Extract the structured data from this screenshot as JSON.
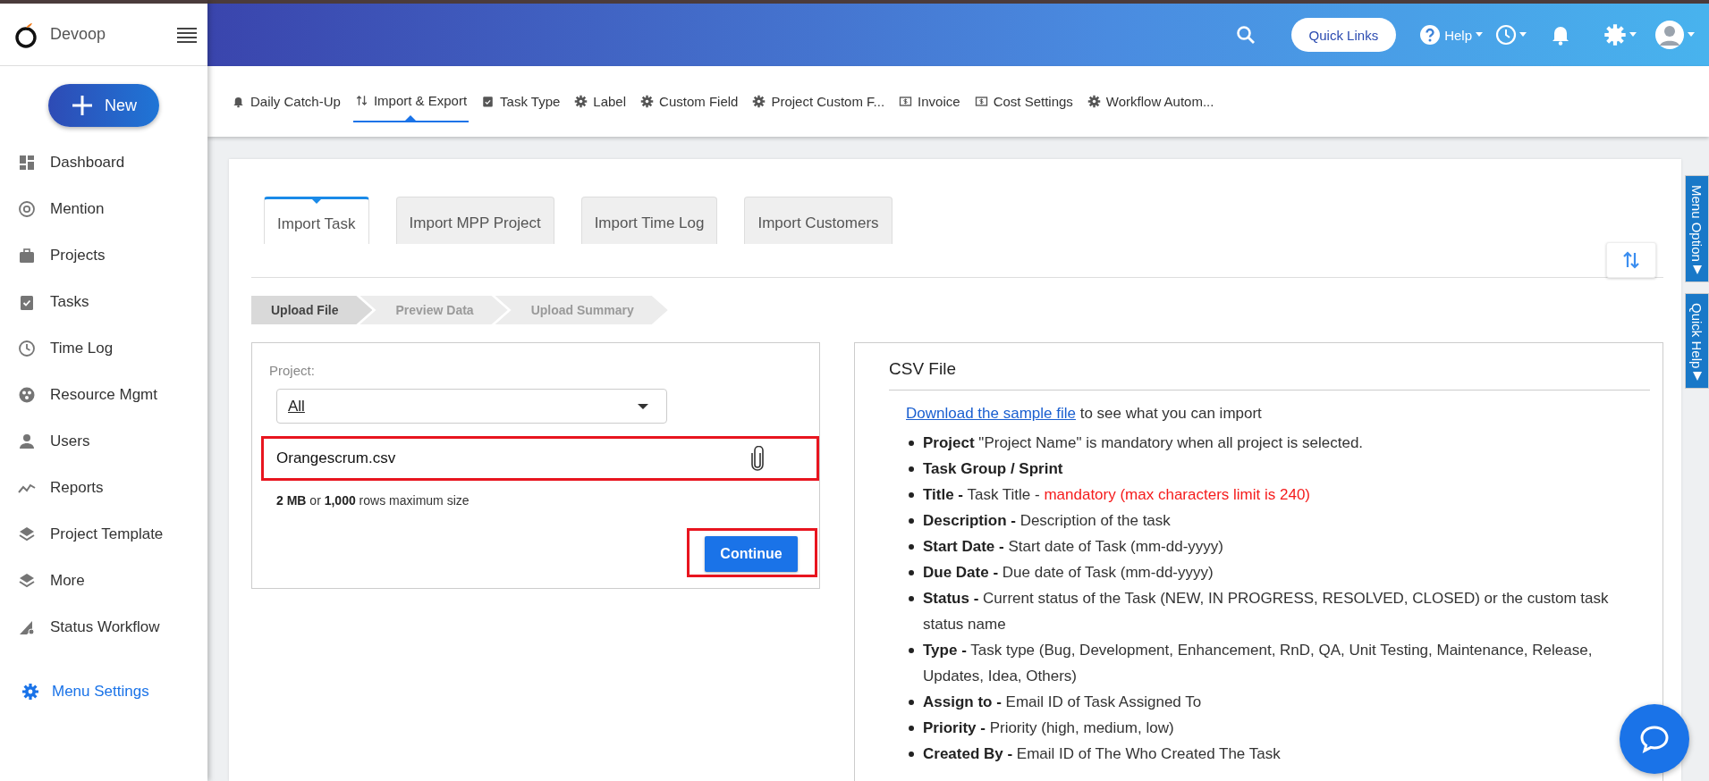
{
  "brand": {
    "name": "Devoop"
  },
  "new_button": {
    "label": "New"
  },
  "sidebar": {
    "items": [
      {
        "label": "Dashboard"
      },
      {
        "label": "Mention"
      },
      {
        "label": "Projects"
      },
      {
        "label": "Tasks"
      },
      {
        "label": "Time Log"
      },
      {
        "label": "Resource Mgmt"
      },
      {
        "label": "Users"
      },
      {
        "label": "Reports"
      },
      {
        "label": "Project Template"
      },
      {
        "label": "More"
      },
      {
        "label": "Status Workflow"
      }
    ],
    "menu_settings": {
      "label": "Menu Settings"
    }
  },
  "header": {
    "quick_links": "Quick Links",
    "help": "Help"
  },
  "subnav": {
    "items": [
      {
        "label": "Daily Catch-Up",
        "selected": false
      },
      {
        "label": "Import & Export",
        "selected": true
      },
      {
        "label": "Task Type",
        "selected": false
      },
      {
        "label": "Label",
        "selected": false
      },
      {
        "label": "Custom Field",
        "selected": false
      },
      {
        "label": "Project Custom F...",
        "selected": false
      },
      {
        "label": "Invoice",
        "selected": false
      },
      {
        "label": "Cost Settings",
        "selected": false
      },
      {
        "label": "Workflow Autom...",
        "selected": false
      }
    ]
  },
  "import_tabs": [
    {
      "label": "Import Task",
      "selected": true
    },
    {
      "label": "Import MPP Project",
      "selected": false
    },
    {
      "label": "Import Time Log",
      "selected": false
    },
    {
      "label": "Import Customers",
      "selected": false
    }
  ],
  "steps": [
    {
      "label": "Upload File",
      "selected": true
    },
    {
      "label": "Preview Data",
      "selected": false
    },
    {
      "label": "Upload Summary",
      "selected": false
    }
  ],
  "form": {
    "project_label": "Project:",
    "project_value": "All",
    "file_name": "Orangescrum.csv",
    "limit_note": "**2 MB** or **1,000** rows maximum size",
    "continue": "Continue"
  },
  "csv_help": {
    "title": "CSV File",
    "link": "Download the sample file",
    "intro": "to see what you can import",
    "fields": [
      {
        "name": "Project",
        "text": "\"Project Name\" is mandatory when all project is selected."
      },
      {
        "name": "Task Group / Sprint"
      },
      {
        "name": "Title -",
        "text": "Task Title -",
        "warning": "mandatory (max characters limit is 240)"
      },
      {
        "name": "Description -",
        "text": "Description of the task"
      },
      {
        "name": "Start Date -",
        "text": "Start date of Task (mm-dd-yyyy)"
      },
      {
        "name": "Due Date -",
        "text": "Due date of Task (mm-dd-yyyy)"
      },
      {
        "name": "Status -",
        "text": "Current status of the Task (NEW, IN PROGRESS, RESOLVED, CLOSED) or the custom task status name"
      },
      {
        "name": "Type -",
        "text": "Task type (Bug, Development, Enhancement, RnD, QA, Unit Testing, Maintenance, Release, Updates, Idea, Others)"
      },
      {
        "name": "Assign to -",
        "text": "Email ID of Task Assigned To"
      },
      {
        "name": "Priority -",
        "text": "Priority (high, medium, low)"
      },
      {
        "name": "Created By -",
        "text": "Email ID of The Who Created The Task"
      }
    ]
  },
  "side_tabs": [
    {
      "label": "Menu Option"
    },
    {
      "label": "Quick Help"
    }
  ]
}
